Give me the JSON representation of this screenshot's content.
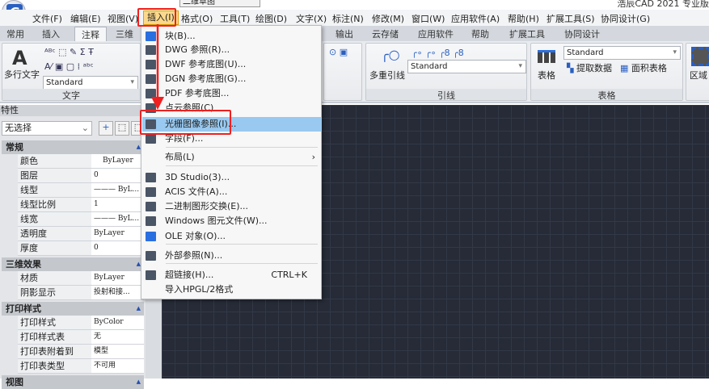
{
  "app": {
    "title": "浩辰CAD 2021 专业版",
    "workspace": "二维草图",
    "logo": "G"
  },
  "menubar": [
    "文件(F)",
    "编辑(E)",
    "视图(V)",
    "插入(I)",
    "格式(O)",
    "工具(T)",
    "绘图(D)",
    "文字(X)",
    "标注(N)",
    "修改(M)",
    "窗口(W)",
    "应用软件(A)",
    "帮助(H)",
    "扩展工具(S)",
    "协同设计(G)"
  ],
  "tabs": [
    "常用",
    "插入",
    "注释",
    "三维",
    "输出",
    "云存储",
    "应用软件",
    "帮助",
    "扩展工具",
    "协同设计"
  ],
  "ribbon": {
    "text_panel": {
      "label": "文字",
      "big_button": "多行文字",
      "style": "Standard"
    },
    "leader_panel": {
      "label": "引线",
      "big_button": "多重引线",
      "style": "Standard"
    },
    "table_panel": {
      "label": "表格",
      "big_button": "表格",
      "style": "Standard",
      "extract": "提取数据",
      "area_table": "面积表格"
    },
    "region_panel": {
      "label": "区域"
    }
  },
  "properties": {
    "title": "特性",
    "selection": "无选择",
    "sections": [
      {
        "title": "常规",
        "rows": [
          [
            "颜色",
            "ByLayer"
          ],
          [
            "图层",
            "0"
          ],
          [
            "线型",
            "——— ByL..."
          ],
          [
            "线型比例",
            "1"
          ],
          [
            "线宽",
            "——— ByL..."
          ],
          [
            "透明度",
            "ByLayer"
          ],
          [
            "厚度",
            "0"
          ]
        ]
      },
      {
        "title": "三维效果",
        "rows": [
          [
            "材质",
            "ByLayer"
          ],
          [
            "阴影显示",
            "投射和接..."
          ]
        ]
      },
      {
        "title": "打印样式",
        "rows": [
          [
            "打印样式",
            "ByColor"
          ],
          [
            "打印样式表",
            "无"
          ],
          [
            "打印表附着到",
            "模型"
          ],
          [
            "打印表类型",
            "不可用"
          ]
        ]
      },
      {
        "title": "视图",
        "rows": []
      }
    ]
  },
  "insert_menu": [
    {
      "label": "块(B)...",
      "icon": "block-icon"
    },
    {
      "label": "DWG 参照(R)...",
      "icon": "dwg-icon"
    },
    {
      "label": "DWF 参考底图(U)...",
      "icon": "dwf-icon"
    },
    {
      "label": "DGN 参考底图(G)...",
      "icon": "dgn-icon"
    },
    {
      "label": "PDF 参考底图...",
      "icon": "pdf-icon"
    },
    {
      "label": "点云参照(C)",
      "icon": "pointcloud-icon"
    },
    {
      "label": "光栅图像参照(I)...",
      "icon": "raster-image-icon",
      "highlighted": true
    },
    {
      "label": "字段(F)...",
      "icon": "field-icon"
    },
    {
      "label": "布局(L)",
      "submenu": true
    },
    {
      "label": "3D Studio(3)...",
      "icon": "3ds-icon"
    },
    {
      "label": "ACIS 文件(A)...",
      "icon": "acis-icon"
    },
    {
      "label": "二进制图形交换(E)...",
      "icon": "dxb-icon"
    },
    {
      "label": "Windows 图元文件(W)...",
      "icon": "wmf-icon"
    },
    {
      "label": "OLE 对象(O)...",
      "icon": "ole-icon"
    },
    {
      "label": "外部参照(N)...",
      "icon": "xref-icon"
    },
    {
      "label": "超链接(H)...",
      "icon": "hyperlink-icon",
      "shortcut": "CTRL+K"
    },
    {
      "label": "导入HPGL/2格式"
    }
  ],
  "colors": {
    "highlight": "#99c9f0",
    "annotation_red": "#f02020",
    "canvas": "#262b37"
  }
}
